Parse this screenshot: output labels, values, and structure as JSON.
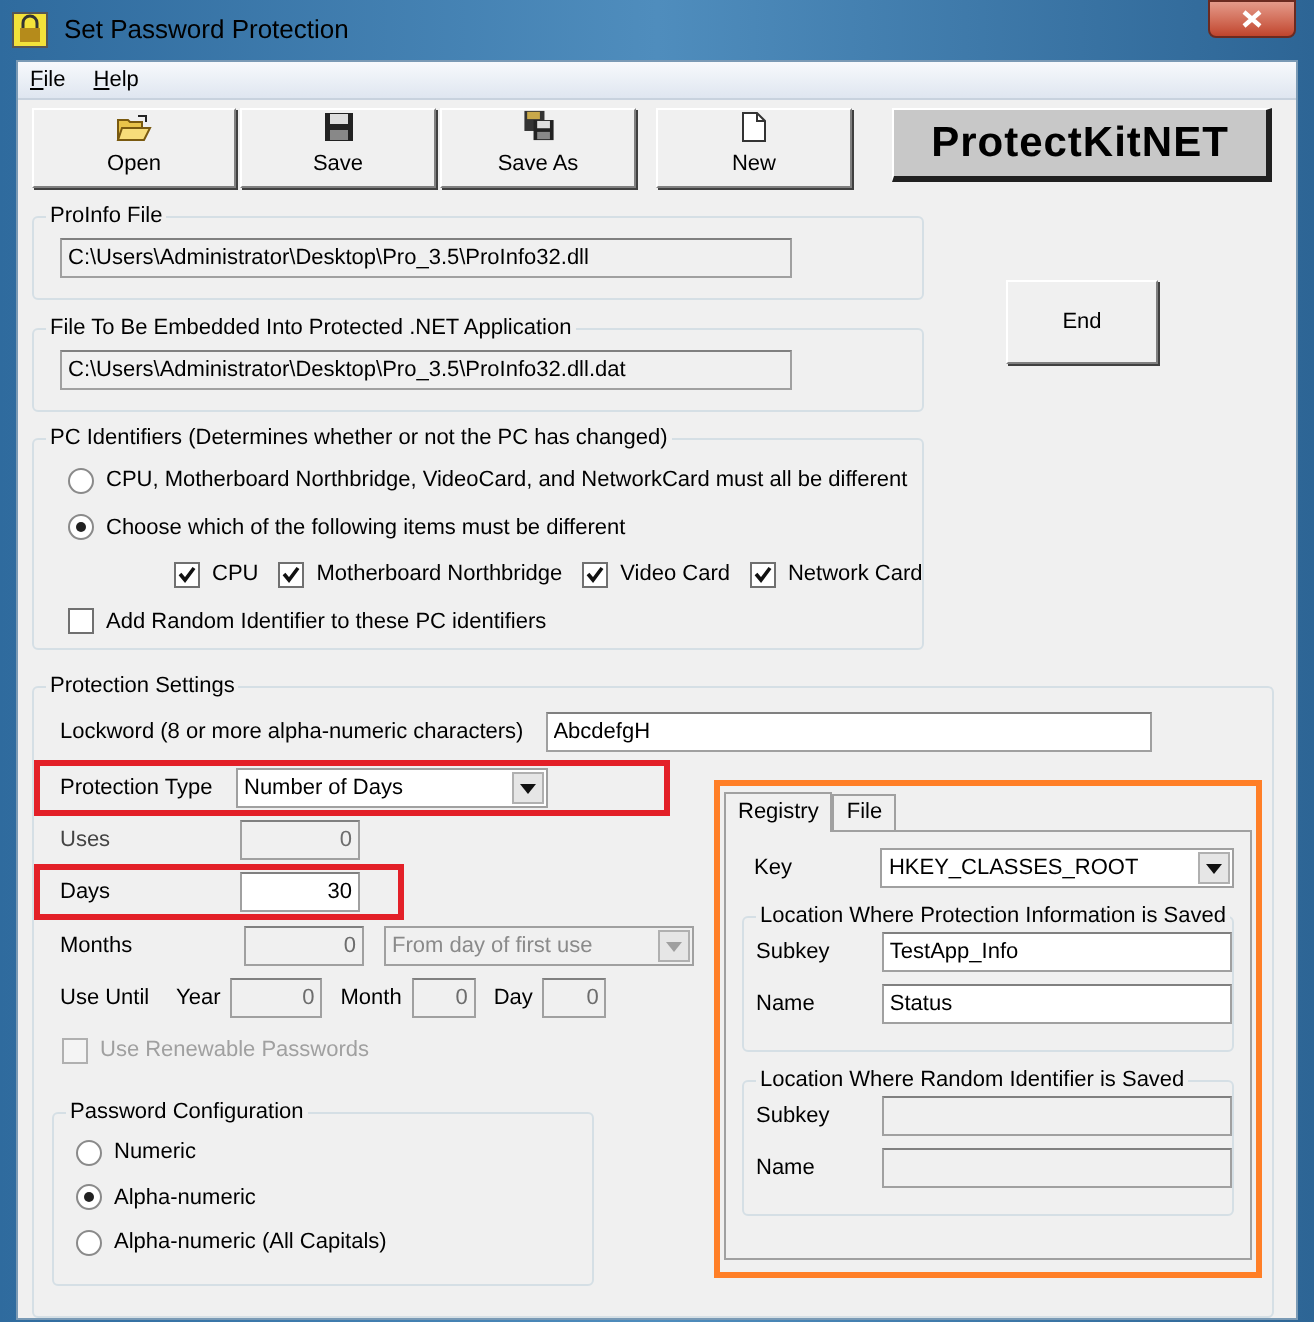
{
  "window": {
    "title": "Set Password Protection"
  },
  "menu": [
    {
      "label": "File"
    },
    {
      "label": "Help"
    }
  ],
  "toolbar": [
    {
      "label": "Open",
      "kind": "open"
    },
    {
      "label": "Save",
      "kind": "save"
    },
    {
      "label": "Save As",
      "kind": "saveas"
    },
    {
      "label": "New",
      "kind": "new"
    }
  ],
  "logo": "ProtectKitNET",
  "end_button": "End",
  "proinfo_file": {
    "title": "ProInfo File",
    "value": "C:\\Users\\Administrator\\Desktop\\Pro_3.5\\ProInfo32.dll"
  },
  "embedded_file": {
    "title": "File To Be Embedded Into Protected .NET Application",
    "value": "C:\\Users\\Administrator\\Desktop\\Pro_3.5\\ProInfo32.dll.dat"
  },
  "pc_identifiers": {
    "title": "PC Identifiers (Determines whether or not the PC has changed)",
    "options": [
      {
        "label": "CPU, Motherboard Northbridge, VideoCard, and NetworkCard must all be different",
        "selected": false
      },
      {
        "label": "Choose which of the following items must be different",
        "selected": true
      }
    ],
    "items": [
      {
        "label": "CPU",
        "checked": true
      },
      {
        "label": "Motherboard Northbridge",
        "checked": true
      },
      {
        "label": "Video Card",
        "checked": true
      },
      {
        "label": "Network Card",
        "checked": true
      }
    ],
    "random": {
      "label": "Add Random Identifier to these PC identifiers",
      "checked": false
    }
  },
  "protection": {
    "title": "Protection Settings",
    "lockword": {
      "label": "Lockword (8 or more alpha-numeric characters)",
      "value": "AbcdefgH"
    },
    "type": {
      "label": "Protection Type",
      "value": "Number of Days"
    },
    "uses": {
      "label": "Uses",
      "value": "0",
      "disabled": true
    },
    "days": {
      "label": "Days",
      "value": "30",
      "disabled": false
    },
    "months": {
      "label": "Months",
      "value": "0",
      "mode": "From day of first use",
      "disabled": true
    },
    "use_until": {
      "label": "Use Until",
      "fields": [
        {
          "label": "Year",
          "value": "0"
        },
        {
          "label": "Month",
          "value": "0"
        },
        {
          "label": "Day",
          "value": "0"
        }
      ]
    },
    "renewable": {
      "label": "Use Renewable Passwords",
      "checked": false,
      "disabled": true
    },
    "password_config": {
      "title": "Password Configuration",
      "options": [
        {
          "label": "Numeric",
          "selected": false
        },
        {
          "label": "Alpha-numeric",
          "selected": true
        },
        {
          "label": "Alpha-numeric (All Capitals)",
          "selected": false
        }
      ]
    }
  },
  "storage": {
    "tabs": [
      {
        "label": "Registry",
        "selected": true
      },
      {
        "label": "File",
        "selected": false
      }
    ],
    "key": {
      "label": "Key",
      "value": "HKEY_CLASSES_ROOT"
    },
    "protection_location": {
      "title": "Location Where Protection Information is Saved",
      "subkey": {
        "label": "Subkey",
        "value": "TestApp_Info"
      },
      "name": {
        "label": "Name",
        "value": "Status"
      }
    },
    "random_location": {
      "title": "Location Where Random Identifier is Saved",
      "subkey": {
        "label": "Subkey"
      },
      "name": {
        "label": "Name"
      }
    }
  }
}
